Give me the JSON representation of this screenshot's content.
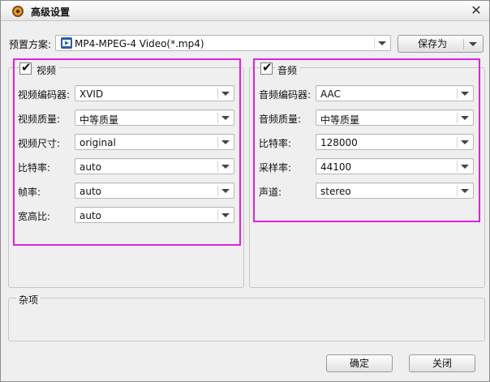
{
  "window": {
    "title": "高级设置"
  },
  "preset": {
    "label": "预置方案:",
    "value": "MP4-MPEG-4 Video(*.mp4)",
    "save_as_label": "保存为"
  },
  "video": {
    "group_title": "视频",
    "enabled": true,
    "fields": [
      {
        "label": "视频编码器:",
        "value": "XVID"
      },
      {
        "label": "视频质量:",
        "value": "中等质量"
      },
      {
        "label": "视频尺寸:",
        "value": "original"
      },
      {
        "label": "比特率:",
        "value": "auto"
      },
      {
        "label": "帧率:",
        "value": "auto"
      },
      {
        "label": "宽高比:",
        "value": "auto"
      }
    ]
  },
  "audio": {
    "group_title": "音频",
    "enabled": true,
    "fields": [
      {
        "label": "音频编码器:",
        "value": "AAC"
      },
      {
        "label": "音频质量:",
        "value": "中等质量"
      },
      {
        "label": "比特率:",
        "value": "128000"
      },
      {
        "label": "采样率:",
        "value": "44100"
      },
      {
        "label": "声道:",
        "value": "stereo"
      }
    ]
  },
  "misc": {
    "group_title": "杂项"
  },
  "buttons": {
    "ok_label": "确定",
    "close_label": "关闭"
  },
  "colors": {
    "highlight": "#e020e0"
  }
}
